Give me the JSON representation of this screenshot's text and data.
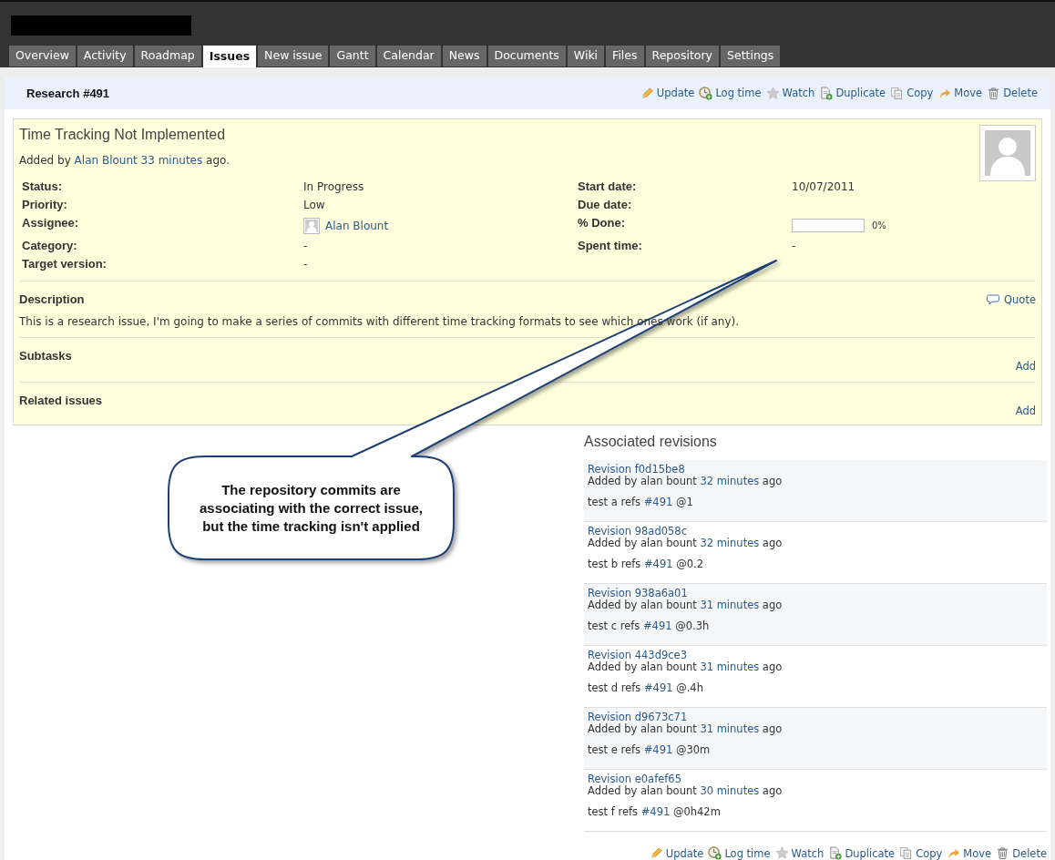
{
  "tabs": [
    {
      "label": "Overview",
      "selected": false
    },
    {
      "label": "Activity",
      "selected": false
    },
    {
      "label": "Roadmap",
      "selected": false
    },
    {
      "label": "Issues",
      "selected": true
    },
    {
      "label": "New issue",
      "selected": false
    },
    {
      "label": "Gantt",
      "selected": false
    },
    {
      "label": "Calendar",
      "selected": false
    },
    {
      "label": "News",
      "selected": false
    },
    {
      "label": "Documents",
      "selected": false
    },
    {
      "label": "Wiki",
      "selected": false
    },
    {
      "label": "Files",
      "selected": false
    },
    {
      "label": "Repository",
      "selected": false
    },
    {
      "label": "Settings",
      "selected": false
    }
  ],
  "issue": {
    "title": "Research #491",
    "actions": [
      {
        "label": "Update",
        "kind": "update"
      },
      {
        "label": "Log time",
        "kind": "log_time"
      },
      {
        "label": "Watch",
        "kind": "watch"
      },
      {
        "label": "Duplicate",
        "kind": "duplicate"
      },
      {
        "label": "Copy",
        "kind": "copy"
      },
      {
        "label": "Move",
        "kind": "move"
      },
      {
        "label": "Delete",
        "kind": "delete"
      }
    ],
    "subject": "Time Tracking Not Implemented",
    "added": {
      "prefix": "Added by",
      "author": "Alan Blount",
      "age": "33 minutes",
      "suffix": "ago."
    },
    "attributes": [
      {
        "label": "Status:",
        "value": "In Progress",
        "kind": "text"
      },
      {
        "label": "Start date:",
        "value": "10/07/2011",
        "kind": "text"
      },
      {
        "label": "Priority:",
        "value": "Low",
        "kind": "text"
      },
      {
        "label": "Due date:",
        "kind": "text"
      },
      {
        "label": "Assignee:",
        "value": "Alan Blount",
        "kind": "user"
      },
      {
        "label": "% Done:",
        "kind": "progress",
        "level": 0,
        "reading": "0%"
      },
      {
        "label": "Category:",
        "value": "-",
        "kind": "text"
      },
      {
        "label": "Spent time:",
        "value": "-",
        "kind": "text"
      },
      {
        "label": "Target version:",
        "value": "-",
        "kind": "text"
      }
    ],
    "description": {
      "heading": "Description",
      "quote": "Quote",
      "text": "This is a research issue, I'm going to make a series of commits with different time tracking formats to see which ones work (if any)."
    },
    "sections": [
      {
        "heading": "Subtasks",
        "action": "Add"
      },
      {
        "heading": "Related issues",
        "action": "Add"
      }
    ]
  },
  "revisions": {
    "heading": "Associated revisions",
    "items": [
      {
        "revision": "Revision f0d15be8",
        "by": "Added by alan bount",
        "age": "32 minutes",
        "suffix": "ago",
        "message": "test a refs",
        "ref": "#491",
        "time": "@1"
      },
      {
        "revision": "Revision 98ad058c",
        "by": "Added by alan bount",
        "age": "32 minutes",
        "suffix": "ago",
        "message": "test b refs",
        "ref": "#491",
        "time": "@0.2"
      },
      {
        "revision": "Revision 938a6a01",
        "by": "Added by alan bount",
        "age": "31 minutes",
        "suffix": "ago",
        "message": "test c refs",
        "ref": "#491",
        "time": "@0.3h"
      },
      {
        "revision": "Revision 443d9ce3",
        "by": "Added by alan bount",
        "age": "31 minutes",
        "suffix": "ago",
        "message": "test d refs",
        "ref": "#491",
        "time": "@.4h"
      },
      {
        "revision": "Revision d9673c71",
        "by": "Added by alan bount",
        "age": "31 minutes",
        "suffix": "ago",
        "message": "test e refs",
        "ref": "#491",
        "time": "@30m"
      },
      {
        "revision": "Revision e0afef65",
        "by": "Added by alan bount",
        "age": "30 minutes",
        "suffix": "ago",
        "message": "test f refs",
        "ref": "#491",
        "time": "@0h42m"
      }
    ]
  },
  "bottom_actions": [
    {
      "label": "Update",
      "kind": "update"
    },
    {
      "label": "Log time",
      "kind": "log_time"
    },
    {
      "label": "Watch",
      "kind": "watch"
    },
    {
      "label": "Duplicate",
      "kind": "duplicate"
    },
    {
      "label": "Copy",
      "kind": "copy"
    },
    {
      "label": "Move",
      "kind": "move"
    },
    {
      "label": "Delete",
      "kind": "delete"
    }
  ],
  "callout": {
    "text": "The repository commits are associating with the correct issue, but the time tracking isn't applied"
  }
}
